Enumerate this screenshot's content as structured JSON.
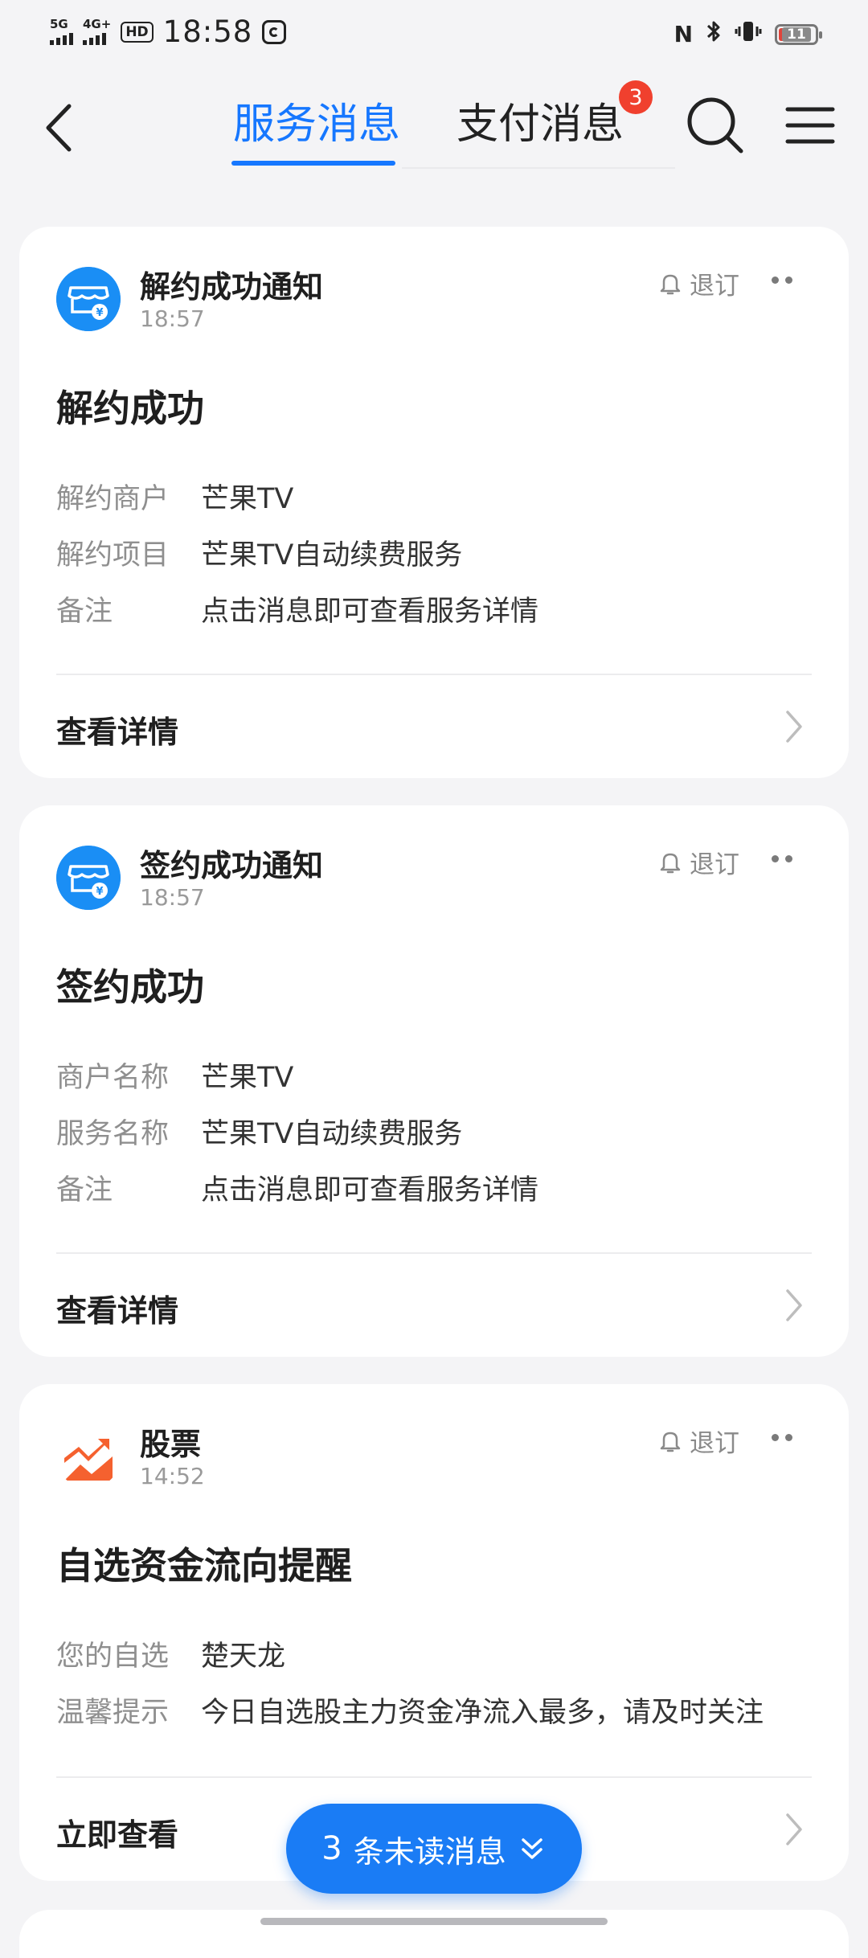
{
  "status_bar": {
    "network1": "5G",
    "network2": "4G+",
    "hd": "HD",
    "time": "18:58",
    "battery": "11"
  },
  "header": {
    "tabs": [
      {
        "label": "服务消息",
        "active": true
      },
      {
        "label": "支付消息",
        "active": false
      }
    ],
    "pay_badge": "3",
    "accent": "#1677ff"
  },
  "cards": [
    {
      "title": "解约成功通知",
      "time": "18:57",
      "unsubscribe": "退订",
      "headline": "解约成功",
      "rows": [
        {
          "k": "解约商户",
          "v": "芒果TV"
        },
        {
          "k": "解约项目",
          "v": "芒果TV自动续费服务"
        },
        {
          "k": "备注",
          "v": "点击消息即可查看服务详情"
        }
      ],
      "action": "查看详情",
      "icon": "service-store-icon"
    },
    {
      "title": "签约成功通知",
      "time": "18:57",
      "unsubscribe": "退订",
      "headline": "签约成功",
      "rows": [
        {
          "k": "商户名称",
          "v": "芒果TV"
        },
        {
          "k": "服务名称",
          "v": "芒果TV自动续费服务"
        },
        {
          "k": "备注",
          "v": "点击消息即可查看服务详情"
        }
      ],
      "action": "查看详情",
      "icon": "service-store-icon"
    },
    {
      "title": "股票",
      "time": "14:52",
      "unsubscribe": "退订",
      "headline": "自选资金流向提醒",
      "rows": [
        {
          "k": "您的自选",
          "v": "楚天龙"
        },
        {
          "k": "温馨提示",
          "v": "今日自选股主力资金净流入最多，请及时关注"
        }
      ],
      "action": "立即查看",
      "icon": "stock-trend-icon"
    }
  ],
  "unread": {
    "count": "3",
    "label": "条未读消息"
  }
}
